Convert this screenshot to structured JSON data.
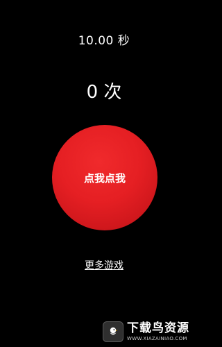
{
  "timer": {
    "text": "10.00 秒"
  },
  "counter": {
    "text": "0 次"
  },
  "tap_button": {
    "label": "点我点我",
    "color": "#e51f23"
  },
  "more_games": {
    "label": "更多游戏"
  },
  "watermark": {
    "title": "下载鸟资源",
    "url": "WWW.XIAZAINIAO.COM",
    "icon": "bird-icon"
  }
}
